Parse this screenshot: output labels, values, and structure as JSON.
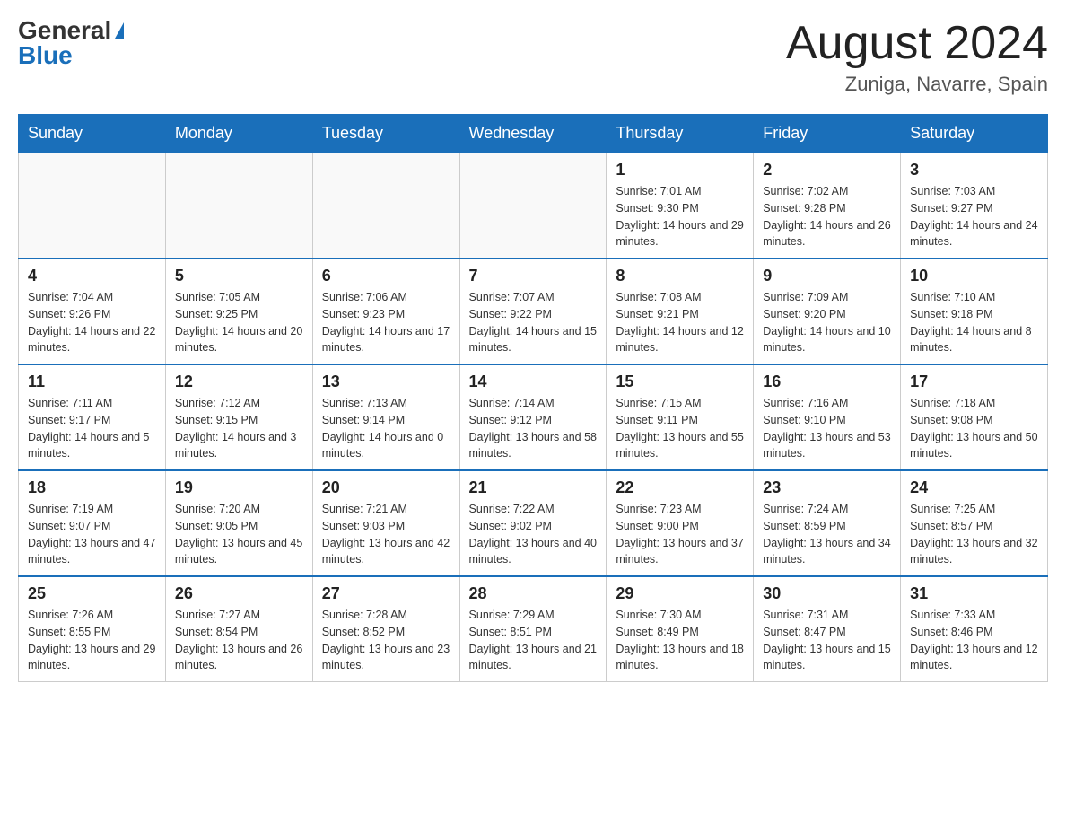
{
  "header": {
    "logo_general": "General",
    "logo_blue": "Blue",
    "month_title": "August 2024",
    "location": "Zuniga, Navarre, Spain"
  },
  "days_of_week": [
    "Sunday",
    "Monday",
    "Tuesday",
    "Wednesday",
    "Thursday",
    "Friday",
    "Saturday"
  ],
  "weeks": [
    [
      {
        "day": "",
        "info": ""
      },
      {
        "day": "",
        "info": ""
      },
      {
        "day": "",
        "info": ""
      },
      {
        "day": "",
        "info": ""
      },
      {
        "day": "1",
        "info": "Sunrise: 7:01 AM\nSunset: 9:30 PM\nDaylight: 14 hours and 29 minutes."
      },
      {
        "day": "2",
        "info": "Sunrise: 7:02 AM\nSunset: 9:28 PM\nDaylight: 14 hours and 26 minutes."
      },
      {
        "day": "3",
        "info": "Sunrise: 7:03 AM\nSunset: 9:27 PM\nDaylight: 14 hours and 24 minutes."
      }
    ],
    [
      {
        "day": "4",
        "info": "Sunrise: 7:04 AM\nSunset: 9:26 PM\nDaylight: 14 hours and 22 minutes."
      },
      {
        "day": "5",
        "info": "Sunrise: 7:05 AM\nSunset: 9:25 PM\nDaylight: 14 hours and 20 minutes."
      },
      {
        "day": "6",
        "info": "Sunrise: 7:06 AM\nSunset: 9:23 PM\nDaylight: 14 hours and 17 minutes."
      },
      {
        "day": "7",
        "info": "Sunrise: 7:07 AM\nSunset: 9:22 PM\nDaylight: 14 hours and 15 minutes."
      },
      {
        "day": "8",
        "info": "Sunrise: 7:08 AM\nSunset: 9:21 PM\nDaylight: 14 hours and 12 minutes."
      },
      {
        "day": "9",
        "info": "Sunrise: 7:09 AM\nSunset: 9:20 PM\nDaylight: 14 hours and 10 minutes."
      },
      {
        "day": "10",
        "info": "Sunrise: 7:10 AM\nSunset: 9:18 PM\nDaylight: 14 hours and 8 minutes."
      }
    ],
    [
      {
        "day": "11",
        "info": "Sunrise: 7:11 AM\nSunset: 9:17 PM\nDaylight: 14 hours and 5 minutes."
      },
      {
        "day": "12",
        "info": "Sunrise: 7:12 AM\nSunset: 9:15 PM\nDaylight: 14 hours and 3 minutes."
      },
      {
        "day": "13",
        "info": "Sunrise: 7:13 AM\nSunset: 9:14 PM\nDaylight: 14 hours and 0 minutes."
      },
      {
        "day": "14",
        "info": "Sunrise: 7:14 AM\nSunset: 9:12 PM\nDaylight: 13 hours and 58 minutes."
      },
      {
        "day": "15",
        "info": "Sunrise: 7:15 AM\nSunset: 9:11 PM\nDaylight: 13 hours and 55 minutes."
      },
      {
        "day": "16",
        "info": "Sunrise: 7:16 AM\nSunset: 9:10 PM\nDaylight: 13 hours and 53 minutes."
      },
      {
        "day": "17",
        "info": "Sunrise: 7:18 AM\nSunset: 9:08 PM\nDaylight: 13 hours and 50 minutes."
      }
    ],
    [
      {
        "day": "18",
        "info": "Sunrise: 7:19 AM\nSunset: 9:07 PM\nDaylight: 13 hours and 47 minutes."
      },
      {
        "day": "19",
        "info": "Sunrise: 7:20 AM\nSunset: 9:05 PM\nDaylight: 13 hours and 45 minutes."
      },
      {
        "day": "20",
        "info": "Sunrise: 7:21 AM\nSunset: 9:03 PM\nDaylight: 13 hours and 42 minutes."
      },
      {
        "day": "21",
        "info": "Sunrise: 7:22 AM\nSunset: 9:02 PM\nDaylight: 13 hours and 40 minutes."
      },
      {
        "day": "22",
        "info": "Sunrise: 7:23 AM\nSunset: 9:00 PM\nDaylight: 13 hours and 37 minutes."
      },
      {
        "day": "23",
        "info": "Sunrise: 7:24 AM\nSunset: 8:59 PM\nDaylight: 13 hours and 34 minutes."
      },
      {
        "day": "24",
        "info": "Sunrise: 7:25 AM\nSunset: 8:57 PM\nDaylight: 13 hours and 32 minutes."
      }
    ],
    [
      {
        "day": "25",
        "info": "Sunrise: 7:26 AM\nSunset: 8:55 PM\nDaylight: 13 hours and 29 minutes."
      },
      {
        "day": "26",
        "info": "Sunrise: 7:27 AM\nSunset: 8:54 PM\nDaylight: 13 hours and 26 minutes."
      },
      {
        "day": "27",
        "info": "Sunrise: 7:28 AM\nSunset: 8:52 PM\nDaylight: 13 hours and 23 minutes."
      },
      {
        "day": "28",
        "info": "Sunrise: 7:29 AM\nSunset: 8:51 PM\nDaylight: 13 hours and 21 minutes."
      },
      {
        "day": "29",
        "info": "Sunrise: 7:30 AM\nSunset: 8:49 PM\nDaylight: 13 hours and 18 minutes."
      },
      {
        "day": "30",
        "info": "Sunrise: 7:31 AM\nSunset: 8:47 PM\nDaylight: 13 hours and 15 minutes."
      },
      {
        "day": "31",
        "info": "Sunrise: 7:33 AM\nSunset: 8:46 PM\nDaylight: 13 hours and 12 minutes."
      }
    ]
  ]
}
